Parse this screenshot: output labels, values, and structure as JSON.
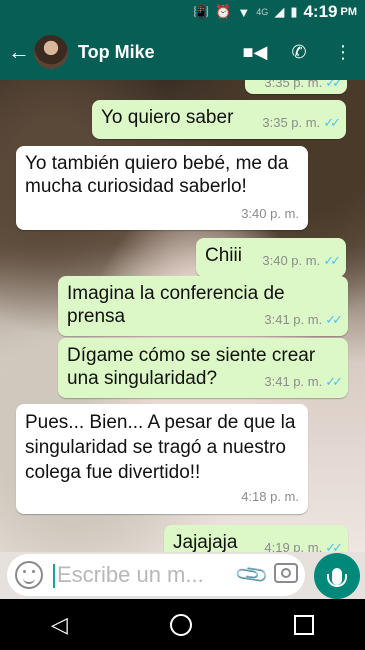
{
  "status_bar": {
    "network": "4G",
    "time": "4:19",
    "ampm": "PM"
  },
  "header": {
    "contact_name": "Top Mike"
  },
  "messages": [
    {
      "direction": "out",
      "text": "",
      "time": "3:35 p. m.",
      "read": true
    },
    {
      "direction": "out",
      "text": "Yo quiero saber",
      "time": "3:35 p. m.",
      "read": true
    },
    {
      "direction": "in",
      "text": "Yo también quiero bebé, me da mucha curiosidad saberlo!",
      "time": "3:40 p. m."
    },
    {
      "direction": "out",
      "text": "Chiii",
      "time": "3:40 p. m.",
      "read": true
    },
    {
      "direction": "out",
      "text": "Imagina la conferencia de prensa",
      "time": "3:41 p. m.",
      "read": true
    },
    {
      "direction": "out",
      "text": "Dígame cómo se siente crear una singularidad?",
      "time": "3:41 p. m.",
      "read": true
    },
    {
      "direction": "in",
      "text": "Pues... Bien... A pesar de que la singularidad se tragó a nuestro colega fue divertido!!",
      "time": "4:18 p. m."
    },
    {
      "direction": "out",
      "text": "Jajajaja",
      "time": "4:19 p. m.",
      "read": true
    }
  ],
  "composer": {
    "placeholder": "Escribe un m..."
  },
  "read_tick_glyph": "✓✓"
}
